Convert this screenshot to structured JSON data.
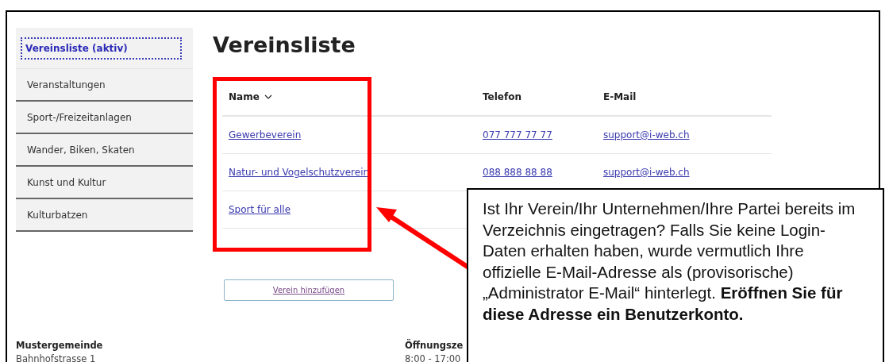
{
  "sidebar": {
    "items": [
      {
        "label": "Vereinsliste (aktiv)",
        "selected": true
      },
      {
        "label": "Veranstaltungen",
        "selected": false
      },
      {
        "label": "Sport-/Freizeitanlagen",
        "selected": false
      },
      {
        "label": "Wander, Biken, Skaten",
        "selected": false
      },
      {
        "label": "Kunst und Kultur",
        "selected": false
      },
      {
        "label": "Kulturbatzen",
        "selected": false
      }
    ]
  },
  "page_title": "Vereinsliste",
  "table": {
    "columns": [
      {
        "label": "Name",
        "sorted": true
      },
      {
        "label": "Telefon",
        "sorted": false
      },
      {
        "label": "E-Mail",
        "sorted": false
      }
    ],
    "rows": [
      {
        "name": "Gewerbeverein",
        "phone": "077 777 77 77",
        "email": "support@i-web.ch"
      },
      {
        "name": "Natur- und Vogelschutzverein",
        "phone": "088 888 88 88",
        "email": "support@i-web.ch"
      },
      {
        "name": "Sport für alle"
      }
    ]
  },
  "add_button": "Verein hinzufügen",
  "footer": {
    "columns": [
      {
        "title": "Mustergemeinde",
        "line": "Bahnhofstrasse 1"
      },
      {
        "title": "Öffnungsze",
        "line": "8:00 - 17:00"
      }
    ]
  },
  "annotation": {
    "text": "Ist Ihr Verein/Ihr Unternehmen/Ihre Partei bereits im Verzeichnis eingetragen? Falls Sie keine Login-Daten erhalten haben, wurde vermutlich Ihre offizielle E-Mail-Adresse als (provisorische) „Administrator E-Mail“ hinterlegt. **Eröffnen Sie für diese Adresse ein Benutzerkonto.**"
  }
}
